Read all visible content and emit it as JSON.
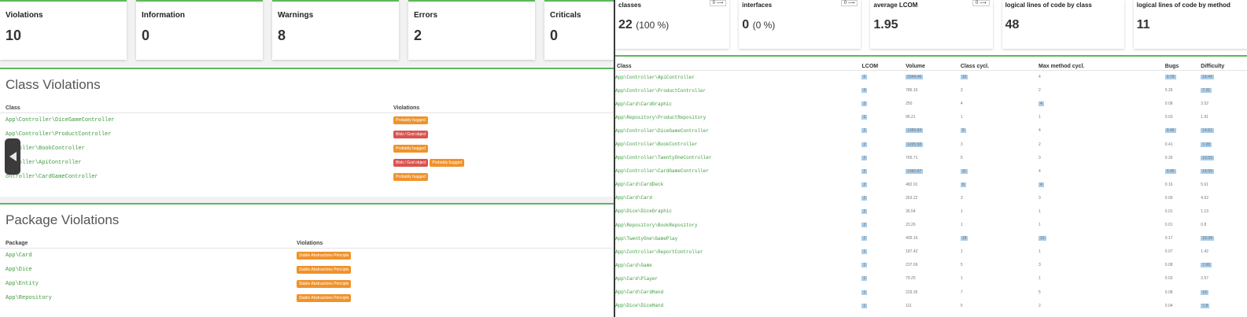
{
  "left": {
    "cards": [
      {
        "title": "Violations",
        "value": "10"
      },
      {
        "title": "Information",
        "value": "0"
      },
      {
        "title": "Warnings",
        "value": "8"
      },
      {
        "title": "Errors",
        "value": "2"
      },
      {
        "title": "Criticals",
        "value": "0"
      }
    ],
    "class_violations": {
      "title": "Class Violations",
      "headers": [
        "Class",
        "Violations"
      ],
      "rows": [
        {
          "name": "App\\Controller\\DiceGameController",
          "badges": [
            {
              "label": "Probably bugged",
              "color": "orange"
            }
          ]
        },
        {
          "name": "App\\Controller\\ProductController",
          "badges": [
            {
              "label": "Blob / God object",
              "color": "red"
            }
          ]
        },
        {
          "name": "ontroller\\BookController",
          "badges": [
            {
              "label": "Probably bugged",
              "color": "orange"
            }
          ]
        },
        {
          "name": "ontroller\\ApiController",
          "badges": [
            {
              "label": "Blob / God object",
              "color": "red"
            },
            {
              "label": "Probably bugged",
              "color": "orange"
            }
          ]
        },
        {
          "name": "ontroller\\CardGameController",
          "badges": [
            {
              "label": "Probably bugged",
              "color": "orange"
            }
          ]
        }
      ]
    },
    "package_violations": {
      "title": "Package Violations",
      "headers": [
        "Package",
        "Violations"
      ],
      "rows": [
        {
          "name": "App\\Card",
          "badges": [
            {
              "label": "Stable Abstractions Principle",
              "color": "orange"
            }
          ]
        },
        {
          "name": "App\\Dice",
          "badges": [
            {
              "label": "Stable Abstractions Principle",
              "color": "orange"
            }
          ]
        },
        {
          "name": "App\\Entity",
          "badges": [
            {
              "label": "Stable Abstractions Principle",
              "color": "orange"
            }
          ]
        },
        {
          "name": "App\\Repository",
          "badges": [
            {
              "label": "Stable Abstractions Principle",
              "color": "orange"
            }
          ]
        }
      ]
    }
  },
  "right": {
    "cards": [
      {
        "title": "classes",
        "value": "22",
        "sub": "(100 %)",
        "toggle": "0 ⟶"
      },
      {
        "title": "interfaces",
        "value": "0",
        "sub": "(0 %)",
        "toggle": "0 ⟶"
      },
      {
        "title": "average LCOM",
        "value": "1.95",
        "sub": "",
        "toggle": "0 ⟶"
      },
      {
        "title": "logical lines of code by class",
        "value": "48",
        "sub": "",
        "toggle": ""
      },
      {
        "title": "logical lines of code by method",
        "value": "11",
        "sub": "",
        "toggle": ""
      }
    ],
    "table": {
      "headers": [
        "Class",
        "LCOM",
        "Volume",
        "Class cycl.",
        "Max method cycl.",
        "Bugs",
        "Difficulty"
      ],
      "rows": [
        {
          "cells": [
            "App\\Controller\\ApiController",
            "6",
            "2344.46",
            "10",
            "4",
            "0.78",
            "14.44"
          ],
          "hl": [
            1,
            2,
            3,
            5,
            6
          ]
        },
        {
          "cells": [
            "App\\Controller\\ProductController",
            "4",
            "786.16",
            "3",
            "2",
            "0.26",
            "7.31"
          ],
          "hl": [
            1,
            6
          ]
        },
        {
          "cells": [
            "App\\Card\\CardGraphic",
            "3",
            "250",
            "4",
            "4",
            "0.08",
            "3.52"
          ],
          "hl": [
            4
          ]
        },
        {
          "cells": [
            "App\\Repository\\ProductRepository",
            "3",
            "96.21",
            "1",
            "1",
            "0.03",
            "1.91"
          ],
          "hl": []
        },
        {
          "cells": [
            "App\\Controller\\DiceGameController",
            "2",
            "1389.84",
            "9",
            "4",
            "0.46",
            "14.51"
          ],
          "hl": [
            2,
            3,
            5,
            6
          ]
        },
        {
          "cells": [
            "App\\Controller\\BookController",
            "2",
            "1225.58",
            "3",
            "2",
            "0.41",
            "7.28"
          ],
          "hl": [
            2,
            6
          ]
        },
        {
          "cells": [
            "App\\Controller\\TwentyOneController",
            "2",
            "765.71",
            "5",
            "3",
            "0.26",
            "13.53"
          ],
          "hl": [
            6
          ]
        },
        {
          "cells": [
            "App\\Controller\\CardGameController",
            "2",
            "1360.87",
            "11",
            "4",
            "0.45",
            "14.59"
          ],
          "hl": [
            2,
            3,
            5,
            6
          ]
        },
        {
          "cells": [
            "App\\Card\\CardDeck",
            "2",
            "482.91",
            "6",
            "4",
            "0.16",
            "5.61"
          ],
          "hl": [
            3,
            4
          ]
        },
        {
          "cells": [
            "App\\Card\\Card",
            "2",
            "263.22",
            "3",
            "3",
            "0.09",
            "4.52"
          ],
          "hl": []
        },
        {
          "cells": [
            "App\\Dice\\DiceGraphic",
            "2",
            "36.54",
            "1",
            "1",
            "0.01",
            "1.13"
          ],
          "hl": []
        },
        {
          "cells": [
            "App\\Repository\\BookRepository",
            "2",
            "23.26",
            "1",
            "1",
            "0.01",
            "0.8"
          ],
          "hl": []
        },
        {
          "cells": [
            "App\\TwentyOne\\GamePlay",
            "2",
            "495.16",
            "18",
            "10",
            "0.17",
            "18.34"
          ],
          "hl": [
            3,
            4,
            6
          ]
        },
        {
          "cells": [
            "App\\Controller\\ReportController",
            "1",
            "187.42",
            "1",
            "1",
            "0.07",
            "1.42"
          ],
          "hl": []
        },
        {
          "cells": [
            "App\\Card\\Game",
            "1",
            "237.69",
            "5",
            "3",
            "0.08",
            "7.06"
          ],
          "hl": [
            6
          ]
        },
        {
          "cells": [
            "App\\Card\\Player",
            "1",
            "79.25",
            "1",
            "1",
            "0.03",
            "2.57"
          ],
          "hl": []
        },
        {
          "cells": [
            "App\\Card\\CardHand",
            "1",
            "229.35",
            "7",
            "5",
            "0.08",
            "19"
          ],
          "hl": [
            6
          ]
        },
        {
          "cells": [
            "App\\Dice\\DiceHand",
            "1",
            "111",
            "5",
            "2",
            "0.04",
            "7.8"
          ],
          "hl": [
            6
          ]
        }
      ]
    }
  }
}
